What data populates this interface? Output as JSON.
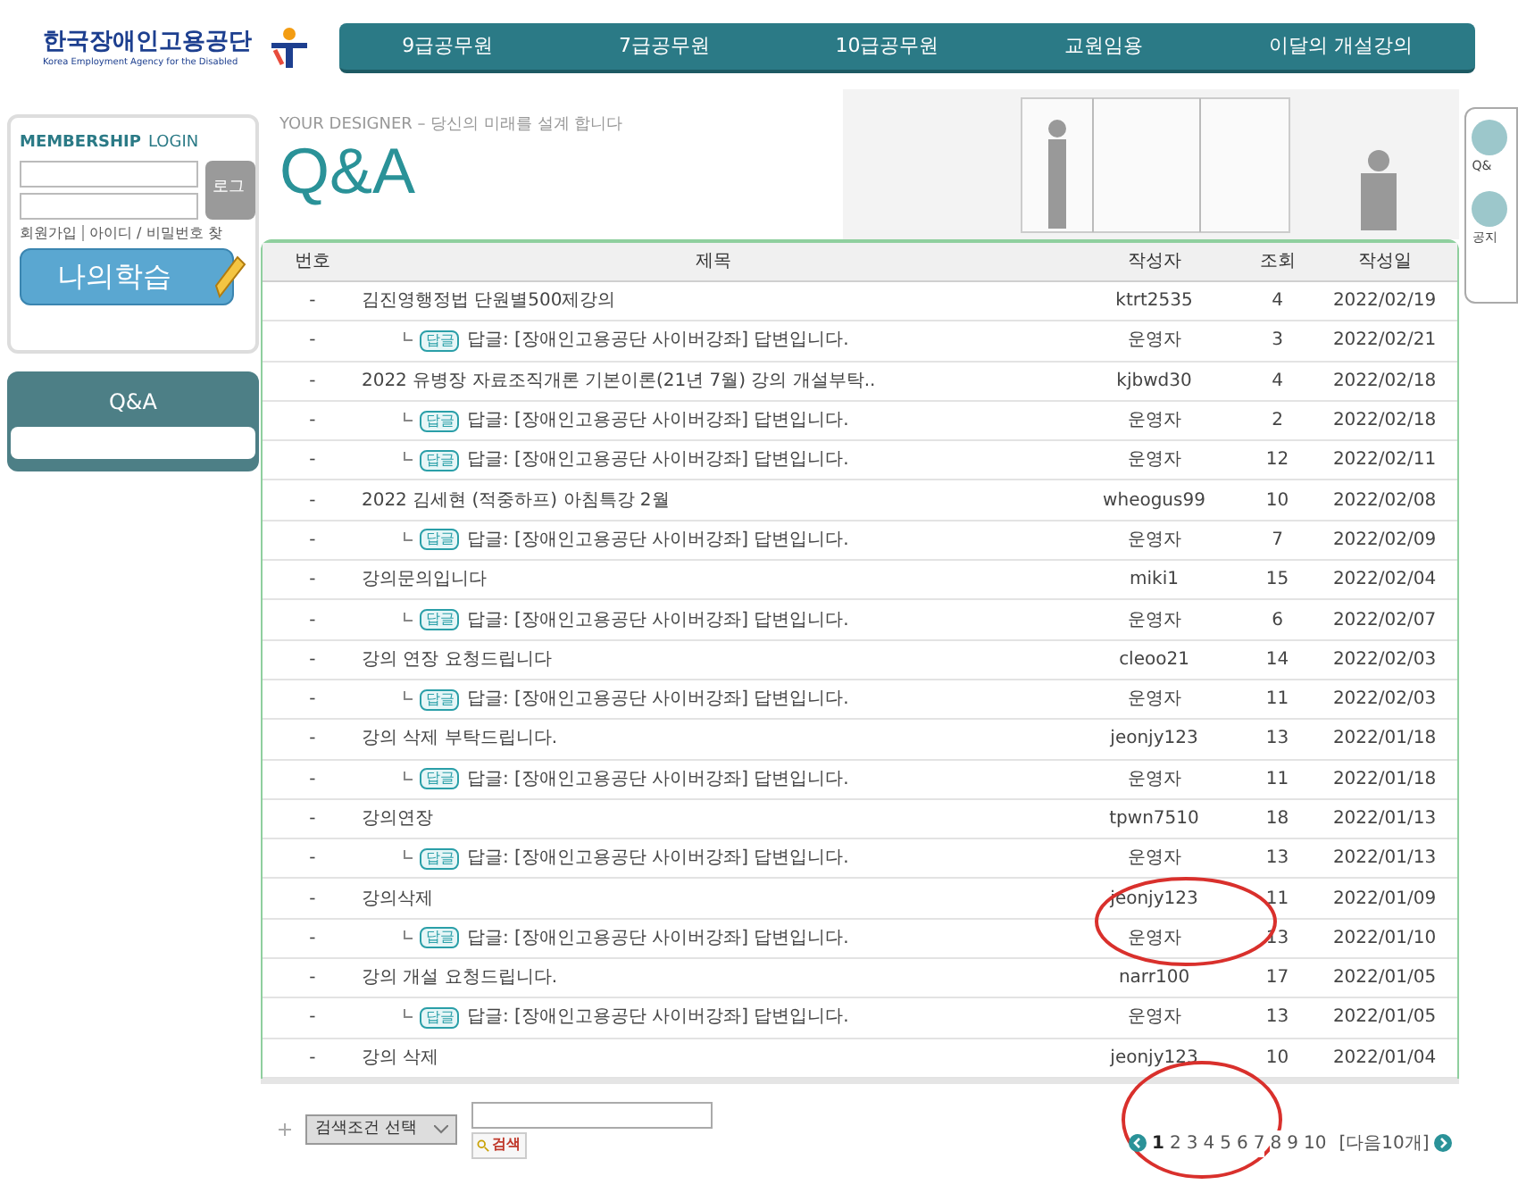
{
  "logo": {
    "name": "한국장애인고용공단",
    "subtitle": "Korea Employment Agency for the Disabled"
  },
  "nav": [
    "9급공무원",
    "7급공무원",
    "10급공무원",
    "교원임용",
    "이달의 개설강의"
  ],
  "login": {
    "title_bold": "MEMBERSHIP",
    "title": "LOGIN",
    "button": "로그",
    "links": [
      "회원가입",
      "아이디 / 비밀번호 찾"
    ],
    "study_button": "나의학습"
  },
  "side_menu": {
    "title": "Q&A"
  },
  "banner": {
    "tagline": "YOUR DESIGNER – 당신의 미래를 설계 합니다",
    "title": "Q&A"
  },
  "quick_menu": [
    "Q&",
    "공지"
  ],
  "table": {
    "columns": [
      "번호",
      "제목",
      "작성자",
      "조회",
      "작성일"
    ],
    "rows": [
      {
        "kind": "post",
        "no": "-",
        "title": "김진영행정법 단원별500제강의",
        "author": "ktrt2535",
        "views": "4",
        "date": "2022/02/19"
      },
      {
        "kind": "reply",
        "no": "-",
        "badge": "답글",
        "title": "답글: [장애인고용공단 사이버강좌] 답변입니다.",
        "author": "운영자",
        "views": "3",
        "date": "2022/02/21"
      },
      {
        "kind": "post",
        "no": "-",
        "title": "2022 유병장 자료조직개론 기본이론(21년 7월) 강의 개설부탁..",
        "author": "kjbwd30",
        "views": "4",
        "date": "2022/02/18"
      },
      {
        "kind": "reply",
        "no": "-",
        "badge": "답글",
        "title": "답글: [장애인고용공단 사이버강좌] 답변입니다.",
        "author": "운영자",
        "views": "2",
        "date": "2022/02/18"
      },
      {
        "kind": "reply",
        "no": "-",
        "badge": "답글",
        "title": "답글: [장애인고용공단 사이버강좌] 답변입니다.",
        "author": "운영자",
        "views": "12",
        "date": "2022/02/11"
      },
      {
        "kind": "post",
        "no": "-",
        "title": "2022 김세현 (적중하프) 아침특강 2월",
        "author": "wheogus99",
        "views": "10",
        "date": "2022/02/08"
      },
      {
        "kind": "reply",
        "no": "-",
        "badge": "답글",
        "title": "답글: [장애인고용공단 사이버강좌] 답변입니다.",
        "author": "운영자",
        "views": "7",
        "date": "2022/02/09"
      },
      {
        "kind": "post",
        "no": "-",
        "title": "강의문의입니다",
        "author": "miki1",
        "views": "15",
        "date": "2022/02/04"
      },
      {
        "kind": "reply",
        "no": "-",
        "badge": "답글",
        "title": "답글: [장애인고용공단 사이버강좌] 답변입니다.",
        "author": "운영자",
        "views": "6",
        "date": "2022/02/07"
      },
      {
        "kind": "post",
        "no": "-",
        "title": "강의 연장 요청드립니다",
        "author": "cleoo21",
        "views": "14",
        "date": "2022/02/03"
      },
      {
        "kind": "reply",
        "no": "-",
        "badge": "답글",
        "title": "답글: [장애인고용공단 사이버강좌] 답변입니다.",
        "author": "운영자",
        "views": "11",
        "date": "2022/02/03"
      },
      {
        "kind": "post",
        "no": "-",
        "title": "강의 삭제 부탁드립니다.",
        "author": "jeonjy123",
        "views": "13",
        "date": "2022/01/18"
      },
      {
        "kind": "reply",
        "no": "-",
        "badge": "답글",
        "title": "답글: [장애인고용공단 사이버강좌] 답변입니다.",
        "author": "운영자",
        "views": "11",
        "date": "2022/01/18"
      },
      {
        "kind": "post",
        "no": "-",
        "title": "강의연장",
        "author": "tpwn7510",
        "views": "18",
        "date": "2022/01/13"
      },
      {
        "kind": "reply",
        "no": "-",
        "badge": "답글",
        "title": "답글: [장애인고용공단 사이버강좌] 답변입니다.",
        "author": "운영자",
        "views": "13",
        "date": "2022/01/13"
      },
      {
        "kind": "post",
        "no": "-",
        "title": "강의삭제",
        "author": "jeonjy123",
        "views": "11",
        "date": "2022/01/09"
      },
      {
        "kind": "reply",
        "no": "-",
        "badge": "답글",
        "title": "답글: [장애인고용공단 사이버강좌] 답변입니다.",
        "author": "운영자",
        "views": "13",
        "date": "2022/01/10"
      },
      {
        "kind": "post",
        "no": "-",
        "title": "강의 개설 요청드립니다.",
        "author": "narr100",
        "views": "17",
        "date": "2022/01/05"
      },
      {
        "kind": "reply",
        "no": "-",
        "badge": "답글",
        "title": "답글: [장애인고용공단 사이버강좌] 답변입니다.",
        "author": "운영자",
        "views": "13",
        "date": "2022/01/05"
      },
      {
        "kind": "post",
        "no": "-",
        "title": "강의 삭제",
        "author": "jeonjy123",
        "views": "10",
        "date": "2022/01/04"
      }
    ]
  },
  "search": {
    "select": "검색조건 선택",
    "button": "검색"
  },
  "pagination": {
    "pages": [
      {
        "label": "1",
        "selected": true
      },
      {
        "label": "2",
        "selected": false
      },
      {
        "label": "3",
        "selected": false
      },
      {
        "label": "4",
        "selected": false
      },
      {
        "label": "5",
        "selected": false
      },
      {
        "label": "6",
        "selected": false
      },
      {
        "label": "7",
        "selected": false
      },
      {
        "label": "8",
        "selected": false
      },
      {
        "label": "9",
        "selected": false
      },
      {
        "label": "10",
        "selected": false
      }
    ],
    "next_group": "[다음10개]"
  }
}
